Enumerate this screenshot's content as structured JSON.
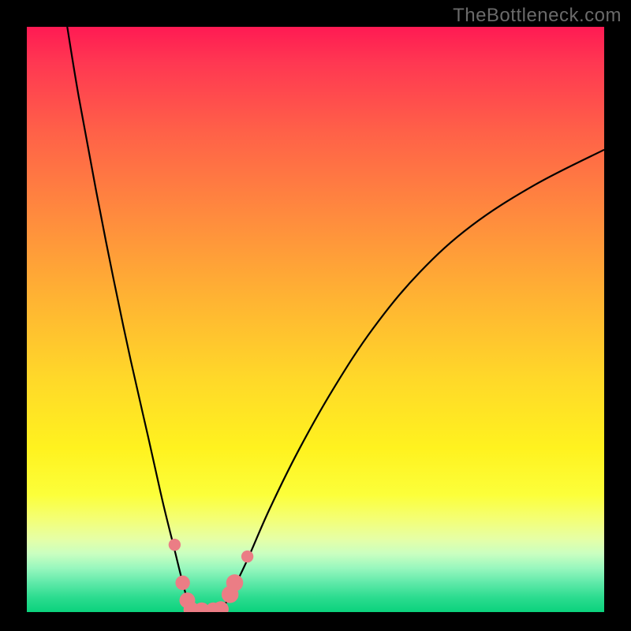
{
  "watermark": "TheBottleneck.com",
  "chart_data": {
    "type": "line",
    "title": "",
    "xlabel": "",
    "ylabel": "",
    "xlim": [
      0,
      100
    ],
    "ylim": [
      0,
      100
    ],
    "grid": false,
    "legend": false,
    "background_gradient": {
      "top_color": "#ff1a53",
      "bottom_color": "#0bd27d",
      "stops": [
        "red",
        "orange",
        "yellow",
        "green"
      ]
    },
    "series": [
      {
        "name": "left_branch",
        "x": [
          7.0,
          9.0,
          12.0,
          15.0,
          18.0,
          21.0,
          23.5,
          25.5,
          27.0,
          28.0,
          28.7
        ],
        "y": [
          100.0,
          88.0,
          72.0,
          57.0,
          43.0,
          30.0,
          19.0,
          11.0,
          5.0,
          1.5,
          0.0
        ]
      },
      {
        "name": "valley_floor",
        "x": [
          28.7,
          30.0,
          32.0,
          33.5
        ],
        "y": [
          0.0,
          0.0,
          0.0,
          0.0
        ]
      },
      {
        "name": "right_branch",
        "x": [
          33.5,
          35.0,
          38.0,
          42.0,
          47.0,
          53.0,
          60.0,
          68.0,
          77.0,
          88.0,
          100.0
        ],
        "y": [
          0.0,
          2.5,
          8.5,
          17.5,
          27.5,
          38.0,
          48.5,
          58.0,
          66.0,
          73.0,
          79.0
        ]
      }
    ],
    "markers": {
      "name": "highlighted_points",
      "color": "#eb7d85",
      "points": [
        {
          "x": 25.6,
          "y": 11.5,
          "r": 1.0
        },
        {
          "x": 27.0,
          "y": 5.0,
          "r": 1.2
        },
        {
          "x": 27.8,
          "y": 2.0,
          "r": 1.3
        },
        {
          "x": 28.5,
          "y": 0.4,
          "r": 1.3
        },
        {
          "x": 30.3,
          "y": 0.3,
          "r": 1.3
        },
        {
          "x": 32.3,
          "y": 0.3,
          "r": 1.3
        },
        {
          "x": 33.6,
          "y": 0.5,
          "r": 1.3
        },
        {
          "x": 35.2,
          "y": 3.0,
          "r": 1.4
        },
        {
          "x": 36.0,
          "y": 5.0,
          "r": 1.4
        },
        {
          "x": 38.2,
          "y": 9.5,
          "r": 1.0
        }
      ]
    }
  }
}
